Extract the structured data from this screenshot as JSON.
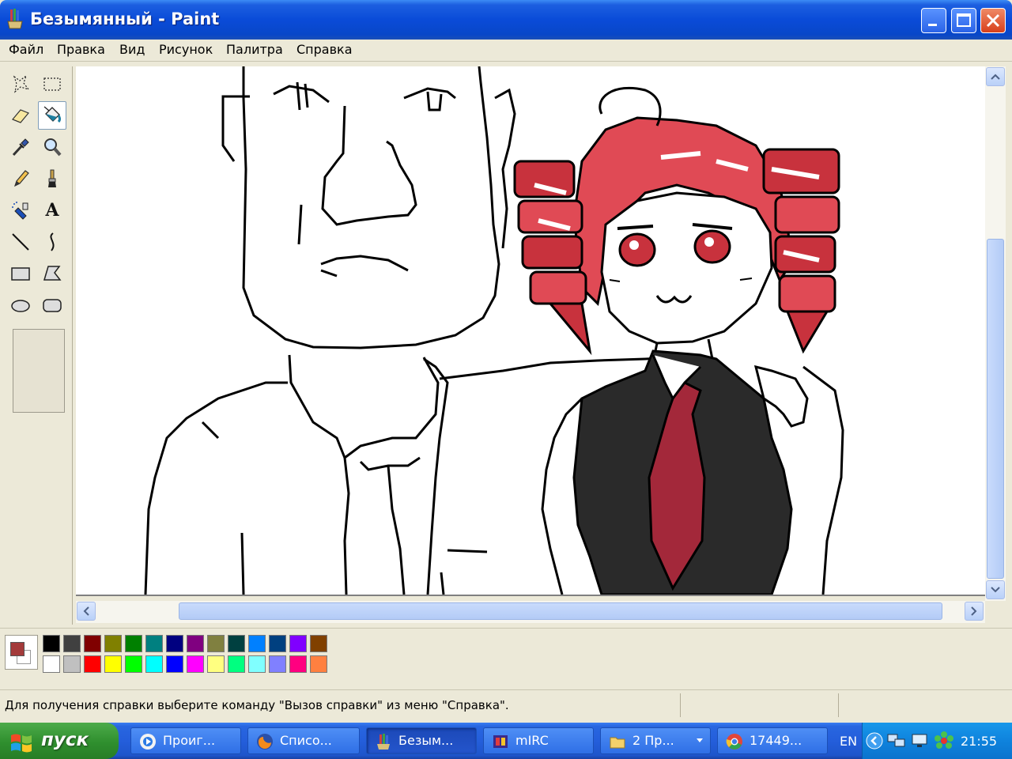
{
  "window": {
    "title": "Безымянный - Paint"
  },
  "menu": [
    "Файл",
    "Правка",
    "Вид",
    "Рисунок",
    "Палитра",
    "Справка"
  ],
  "tools": [
    {
      "name": "free-select-icon"
    },
    {
      "name": "rect-select-icon"
    },
    {
      "name": "eraser-icon"
    },
    {
      "name": "fill-bucket-icon",
      "active": true
    },
    {
      "name": "color-picker-icon"
    },
    {
      "name": "magnifier-icon"
    },
    {
      "name": "pencil-icon"
    },
    {
      "name": "brush-icon"
    },
    {
      "name": "airbrush-icon"
    },
    {
      "name": "text-icon"
    },
    {
      "name": "line-icon"
    },
    {
      "name": "curve-icon"
    },
    {
      "name": "rectangle-icon"
    },
    {
      "name": "polygon-icon"
    },
    {
      "name": "ellipse-icon"
    },
    {
      "name": "rounded-rect-icon"
    }
  ],
  "text_tool_glyph": "A",
  "colors": {
    "foreground": "#a33a3a",
    "background": "#ffffff",
    "palette_top": [
      "#000000",
      "#404040",
      "#800000",
      "#808000",
      "#008000",
      "#008080",
      "#000080",
      "#800080",
      "#808040",
      "#004040",
      "#0080ff",
      "#004080",
      "#8000ff",
      "#804000"
    ],
    "palette_bottom": [
      "#ffffff",
      "#c0c0c0",
      "#ff0000",
      "#ffff00",
      "#00ff00",
      "#00ffff",
      "#0000ff",
      "#ff00ff",
      "#ffff80",
      "#00ff80",
      "#80ffff",
      "#8080ff",
      "#ff0080",
      "#ff8040"
    ]
  },
  "status": {
    "text": "Для получения справки выберите команду \"Вызов справки\" из меню \"Справка\"."
  },
  "taskbar": {
    "start_label": "пуск",
    "tasks": [
      {
        "label": "Проиг...",
        "icon": "media-player-icon"
      },
      {
        "label": "Списо...",
        "icon": "firefox-icon"
      },
      {
        "label": "Безым...",
        "icon": "paint-icon",
        "active": true
      },
      {
        "label": "mIRC",
        "icon": "mirc-icon"
      },
      {
        "label": "2 Пр...",
        "icon": "folder-icon"
      },
      {
        "label": "17449...",
        "icon": "chrome-icon"
      }
    ],
    "language": "EN",
    "clock": "21:55"
  }
}
